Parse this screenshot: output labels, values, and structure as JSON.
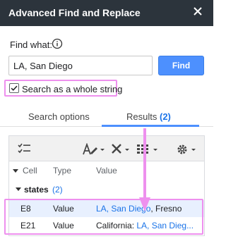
{
  "dialog": {
    "title": "Advanced Find and Replace"
  },
  "find": {
    "label": "Find what:",
    "value": "LA, San Diego",
    "button": "Find"
  },
  "options": {
    "whole_string_label": "Search as a whole string",
    "whole_string_checked": true
  },
  "tabs": {
    "search_options": "Search options",
    "results": "Results",
    "results_count": "(2)"
  },
  "results_table": {
    "columns": [
      "Cell",
      "Type",
      "Value"
    ],
    "group": {
      "name": "states",
      "count": "(2)"
    },
    "rows": [
      {
        "cell": "E8",
        "type": "Value",
        "value_match": "LA, San Diego",
        "value_rest": ", Fresno",
        "value_prefix": ""
      },
      {
        "cell": "E21",
        "type": "Value",
        "value_prefix": "California: ",
        "value_match": "LA, San Dieg...",
        "value_rest": ""
      }
    ]
  },
  "icons": [
    "close-icon",
    "info-icon",
    "select-all-icon",
    "replace-format-icon",
    "delete-icon",
    "columns-icon",
    "settings-icon"
  ],
  "colors": {
    "titlebar": "#2c343c",
    "accent": "#4d90fe",
    "highlight": "#ee90ee",
    "link": "#1a73e8"
  }
}
